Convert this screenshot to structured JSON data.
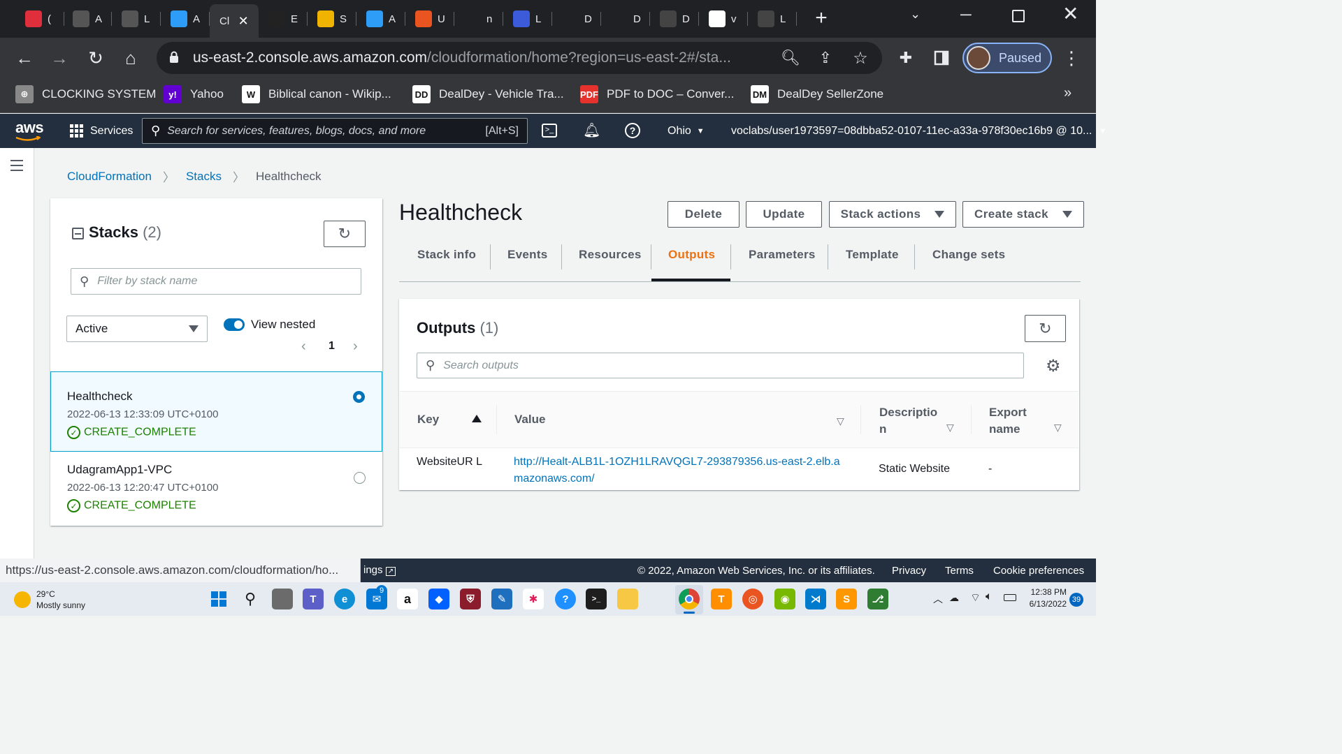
{
  "browser": {
    "tabs": [
      {
        "abbr": "(",
        "icon": "app-grid-icon",
        "color": "#e02f3c"
      },
      {
        "abbr": "A",
        "icon": "laptop-icon",
        "color": "#555"
      },
      {
        "abbr": "L",
        "icon": "laptop-icon",
        "color": "#555"
      },
      {
        "abbr": "A",
        "icon": "udacity-icon",
        "color": "#2e9df7"
      },
      {
        "abbr": "Cl",
        "icon": "close-icon",
        "color": "#35363a",
        "active": true
      },
      {
        "abbr": "E",
        "icon": "graduation-cap-icon",
        "color": "#222"
      },
      {
        "abbr": "S",
        "icon": "package-icon",
        "color": "#f0b400"
      },
      {
        "abbr": "A",
        "icon": "udacity-icon",
        "color": "#2e9df7"
      },
      {
        "abbr": "U",
        "icon": "ubuntu-icon",
        "color": "#e95420"
      },
      {
        "abbr": "n",
        "icon": "github-icon",
        "color": "#202124"
      },
      {
        "abbr": "L",
        "icon": "udacity-icon",
        "color": "#3b5bdb"
      },
      {
        "abbr": "D",
        "icon": "github-icon",
        "color": "#202124"
      },
      {
        "abbr": "D",
        "icon": "github-icon",
        "color": "#202124"
      },
      {
        "abbr": "D",
        "icon": "doc-icon",
        "color": "#444"
      },
      {
        "abbr": "v",
        "icon": "google-icon",
        "color": "#fff"
      },
      {
        "abbr": "L",
        "icon": "feather-icon",
        "color": "#444"
      }
    ],
    "url_host": "us-east-2.console.aws.amazon.com",
    "url_path": "/cloudformation/home?region=us-east-2#/sta...",
    "profile_label": "Paused",
    "bookmarks": [
      {
        "label": "CLOCKING SYSTEM",
        "icon": "globe-icon",
        "color": "#888",
        "text": "⊕"
      },
      {
        "label": "Yahoo",
        "icon": "yahoo-icon",
        "color": "#6001d2",
        "text": "y!"
      },
      {
        "label": "Biblical canon - Wikip...",
        "icon": "wikipedia-icon",
        "color": "#fff",
        "text": "W"
      },
      {
        "label": "DealDey - Vehicle Tra...",
        "icon": "dealdey-icon",
        "color": "#fff",
        "text": "DD"
      },
      {
        "label": "PDF to DOC – Conver...",
        "icon": "pdf-icon",
        "color": "#e5322d",
        "text": "PDF"
      },
      {
        "label": "DealDey SellerZone",
        "icon": "dealdey-icon",
        "color": "#fff",
        "text": "DM"
      }
    ]
  },
  "aws_nav": {
    "logo": "aws",
    "services_label": "Services",
    "search_placeholder": "Search for services, features, blogs, docs, and more",
    "search_shortcut": "[Alt+S]",
    "region": "Ohio",
    "account": "voclabs/user1973597=08dbba52-0107-11ec-a33a-978f30ec16b9 @ 10..."
  },
  "breadcrumb": [
    "CloudFormation",
    "Stacks",
    "Healthcheck"
  ],
  "stacks_panel": {
    "title": "Stacks",
    "count": "(2)",
    "filter_placeholder": "Filter by stack name",
    "status_filter": "Active",
    "view_nested_label": "View nested",
    "view_nested_on": true,
    "page": "1",
    "stacks": [
      {
        "name": "Healthcheck",
        "date": "2022-06-13 12:33:09 UTC+0100",
        "status": "CREATE_COMPLETE",
        "selected": true
      },
      {
        "name": "UdagramApp1-VPC",
        "date": "2022-06-13 12:20:47 UTC+0100",
        "status": "CREATE_COMPLETE",
        "selected": false
      }
    ]
  },
  "stack_detail": {
    "title": "Healthcheck",
    "buttons": {
      "delete": "Delete",
      "update": "Update",
      "stack_actions": "Stack actions",
      "create_stack": "Create stack"
    },
    "tabs": [
      "Stack info",
      "Events",
      "Resources",
      "Outputs",
      "Parameters",
      "Template",
      "Change sets"
    ],
    "active_tab": "Outputs"
  },
  "outputs": {
    "title": "Outputs",
    "count": "(1)",
    "search_placeholder": "Search outputs",
    "columns": {
      "key": "Key",
      "value": "Value",
      "description": "Descriptio n",
      "export": "Export name"
    },
    "rows": [
      {
        "key": "WebsiteUR L",
        "value": "http://Healt-ALB1L-1OZH1LRAVQGL7-293879356.us-east-2.elb.amazonaws.com/",
        "description": "Static Website",
        "export": "-"
      }
    ]
  },
  "status_bar_url": "https://us-east-2.console.aws.amazon.com/cloudformation/ho...",
  "footer": {
    "feedback_fragment": "ings",
    "copyright": "© 2022, Amazon Web Services, Inc. or its affiliates.",
    "links": [
      "Privacy",
      "Terms",
      "Cookie preferences"
    ]
  },
  "taskbar": {
    "weather_temp": "29°C",
    "weather_desc": "Mostly sunny",
    "time": "12:38 PM",
    "date": "6/13/2022",
    "notification_count": "39",
    "mail_badge": "9"
  }
}
